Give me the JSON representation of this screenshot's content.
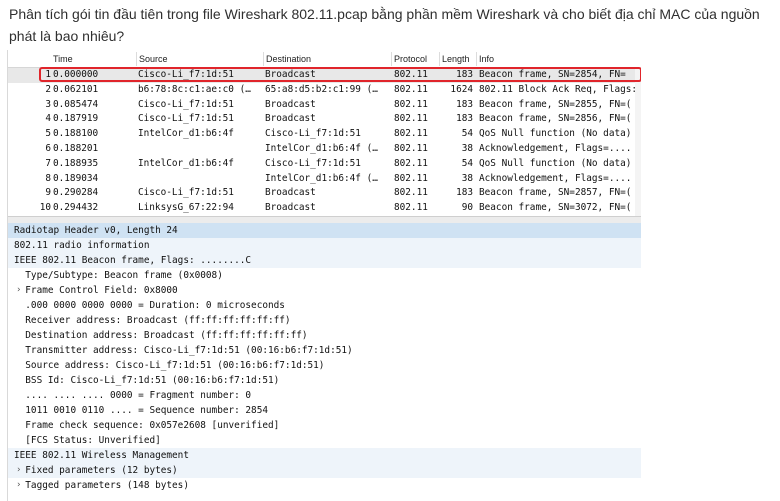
{
  "question": "Phân tích gói tin đầu tiên trong file Wireshark 802.11.pcap bằng phần mềm Wireshark và cho biết địa chỉ MAC của nguồn phát là bao nhiêu?",
  "packet_list": {
    "columns": [
      "Time",
      "Source",
      "Destination",
      "Protocol",
      "Length",
      "Info"
    ],
    "rows": [
      {
        "no": "1",
        "time": "0.000000",
        "src": "Cisco-Li_f7:1d:51",
        "dst": "Broadcast",
        "proto": "802.11",
        "len": "183",
        "info": "Beacon frame, SN=2854, FN="
      },
      {
        "no": "2",
        "time": "0.062101",
        "src": "b6:78:8c:c1:ae:c0 (…",
        "dst": "65:a8:d5:b2:c1:99 (…",
        "proto": "802.11",
        "len": "1624",
        "info": "802.11 Block Ack Req, Flags:"
      },
      {
        "no": "3",
        "time": "0.085474",
        "src": "Cisco-Li_f7:1d:51",
        "dst": "Broadcast",
        "proto": "802.11",
        "len": "183",
        "info": "Beacon frame, SN=2855, FN=("
      },
      {
        "no": "4",
        "time": "0.187919",
        "src": "Cisco-Li_f7:1d:51",
        "dst": "Broadcast",
        "proto": "802.11",
        "len": "183",
        "info": "Beacon frame, SN=2856, FN=("
      },
      {
        "no": "5",
        "time": "0.188100",
        "src": "IntelCor_d1:b6:4f",
        "dst": "Cisco-Li_f7:1d:51",
        "proto": "802.11",
        "len": "54",
        "info": "QoS Null function (No data)"
      },
      {
        "no": "6",
        "time": "0.188201",
        "src": "",
        "dst": "IntelCor_d1:b6:4f (…",
        "proto": "802.11",
        "len": "38",
        "info": "Acknowledgement, Flags=...."
      },
      {
        "no": "7",
        "time": "0.188935",
        "src": "IntelCor_d1:b6:4f",
        "dst": "Cisco-Li_f7:1d:51",
        "proto": "802.11",
        "len": "54",
        "info": "QoS Null function (No data)"
      },
      {
        "no": "8",
        "time": "0.189034",
        "src": "",
        "dst": "IntelCor_d1:b6:4f (…",
        "proto": "802.11",
        "len": "38",
        "info": "Acknowledgement, Flags=...."
      },
      {
        "no": "9",
        "time": "0.290284",
        "src": "Cisco-Li_f7:1d:51",
        "dst": "Broadcast",
        "proto": "802.11",
        "len": "183",
        "info": "Beacon frame, SN=2857, FN=("
      },
      {
        "no": "10",
        "time": "0.294432",
        "src": "LinksysG_67:22:94",
        "dst": "Broadcast",
        "proto": "802.11",
        "len": "90",
        "info": "Beacon frame, SN=3072, FN=("
      }
    ]
  },
  "details": [
    {
      "text": "Radiotap Header v0, Length 24",
      "style": "hl"
    },
    {
      "text": "802.11 radio information",
      "style": "sub"
    },
    {
      "text": "IEEE 802.11 Beacon frame, Flags: ........C",
      "style": "sub"
    },
    {
      "text": "  Type/Subtype: Beacon frame (0x0008)",
      "style": ""
    },
    {
      "text": "  Frame Control Field: 0x8000",
      "style": "",
      "arrow": "›"
    },
    {
      "text": "  .000 0000 0000 0000 = Duration: 0 microseconds",
      "style": ""
    },
    {
      "text": "  Receiver address: Broadcast (ff:ff:ff:ff:ff:ff)",
      "style": ""
    },
    {
      "text": "  Destination address: Broadcast (ff:ff:ff:ff:ff:ff)",
      "style": ""
    },
    {
      "text": "  Transmitter address: Cisco-Li_f7:1d:51 (00:16:b6:f7:1d:51)",
      "style": ""
    },
    {
      "text": "  Source address: Cisco-Li_f7:1d:51 (00:16:b6:f7:1d:51)",
      "style": ""
    },
    {
      "text": "  BSS Id: Cisco-Li_f7:1d:51 (00:16:b6:f7:1d:51)",
      "style": ""
    },
    {
      "text": "  .... .... .... 0000 = Fragment number: 0",
      "style": ""
    },
    {
      "text": "  1011 0010 0110 .... = Sequence number: 2854",
      "style": ""
    },
    {
      "text": "  Frame check sequence: 0x057e2608 [unverified]",
      "style": ""
    },
    {
      "text": "  [FCS Status: Unverified]",
      "style": ""
    },
    {
      "text": "IEEE 802.11 Wireless Management",
      "style": "sub"
    },
    {
      "text": "  Fixed parameters (12 bytes)",
      "style": "sub",
      "arrow": "›"
    },
    {
      "text": "  Tagged parameters (148 bytes)",
      "style": "",
      "arrow": "›"
    }
  ],
  "colors": {
    "selection_box": "#e0252b",
    "detail_highlight": "#cfe2f3"
  }
}
